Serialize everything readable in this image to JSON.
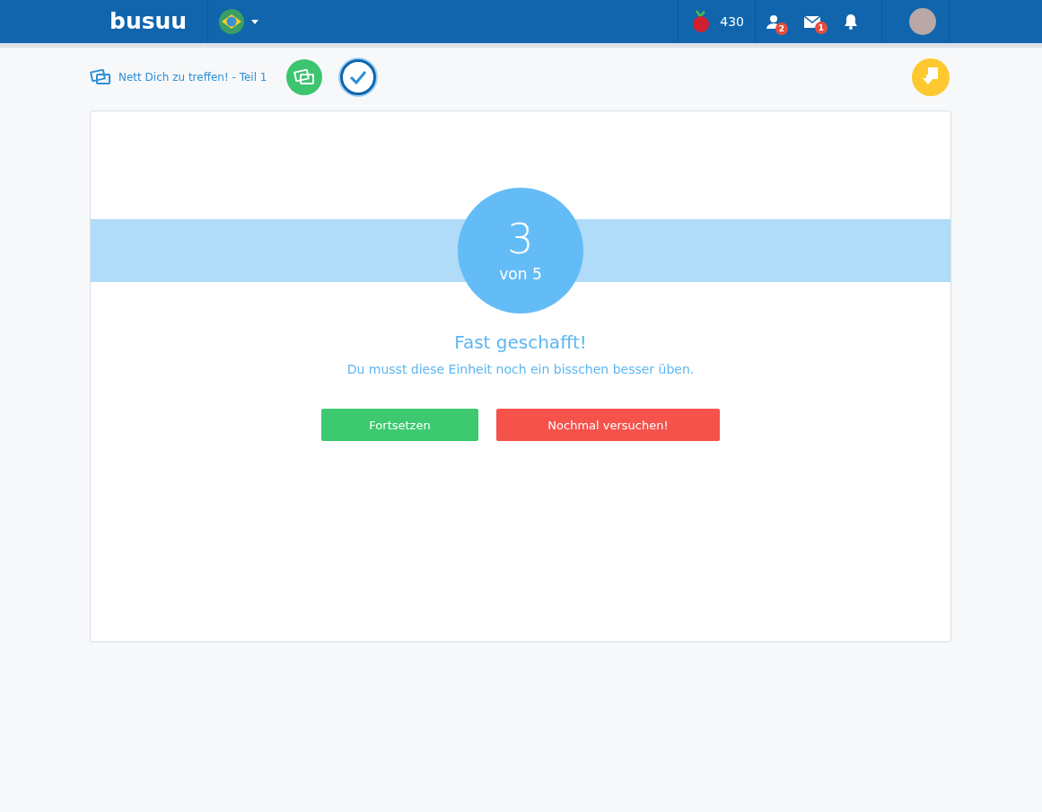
{
  "header": {
    "logo": "busuu",
    "points": "430",
    "friend_requests": "2",
    "messages": "1"
  },
  "lesson": {
    "title": "Nett Dich zu treffen! - Teil 1",
    "steps": [
      {
        "kind": "cards",
        "selected": false
      },
      {
        "kind": "check",
        "selected": true
      }
    ]
  },
  "result": {
    "score": "3",
    "total": "von 5",
    "headline": "Fast geschafft!",
    "message": "Du musst diese Einheit noch ein bisschen besser üben.",
    "buttons": [
      {
        "label": "Fortsetzen",
        "kind": "continue"
      },
      {
        "label": "Nochmal versuchen!",
        "kind": "retry"
      }
    ]
  }
}
